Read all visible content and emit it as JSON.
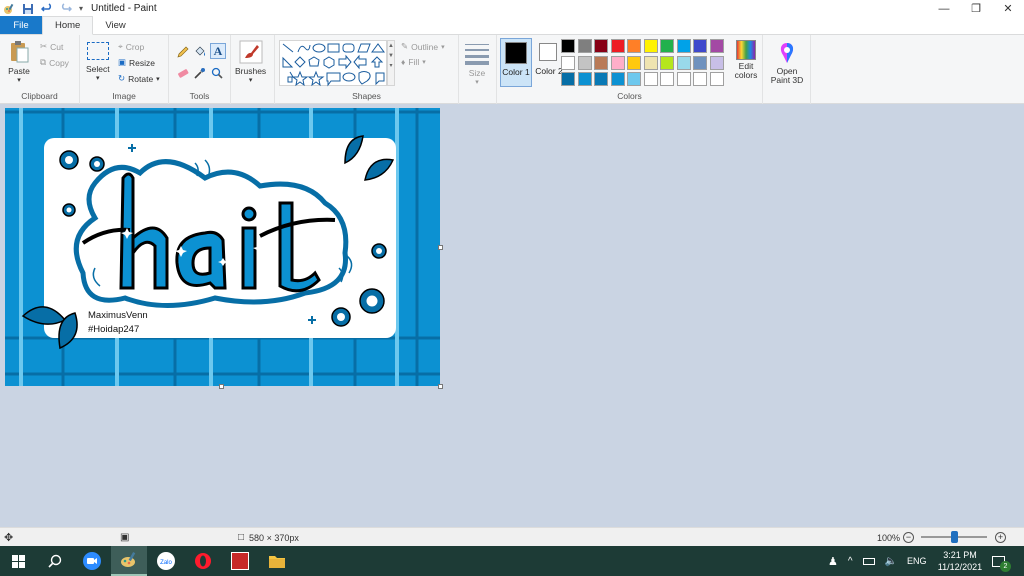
{
  "window": {
    "title": "Untitled - Paint"
  },
  "tabs": [
    {
      "label": "File"
    },
    {
      "label": "Home"
    },
    {
      "label": "View"
    }
  ],
  "clipboard": {
    "paste": "Paste",
    "cut": "Cut",
    "copy": "Copy",
    "group": "Clipboard"
  },
  "image": {
    "select": "Select",
    "crop": "Crop",
    "resize": "Resize",
    "rotate": "Rotate",
    "group": "Image"
  },
  "tools": {
    "group": "Tools",
    "brushes": "Brushes"
  },
  "shapes": {
    "outline": "Outline",
    "fill": "Fill",
    "group": "Shapes"
  },
  "size": {
    "label": "Size"
  },
  "colors": {
    "color1_label": "Color 1",
    "color2_label": "Color 2",
    "color1": "#000000",
    "color2": "#ffffff",
    "edit_colors": "Edit colors",
    "group": "Colors",
    "palette": [
      [
        "#000000",
        "#7f7f7f",
        "#880015",
        "#ed1c24",
        "#ff7f27",
        "#fff200",
        "#22b14c",
        "#00a2e8",
        "#3f48cc",
        "#a349a4"
      ],
      [
        "#ffffff",
        "#c3c3c3",
        "#b97a57",
        "#ffaec9",
        "#ffc90e",
        "#efe4b0",
        "#b5e61d",
        "#99d9ea",
        "#7092be",
        "#c8bfe7"
      ],
      [
        "#076ea6",
        "#0c91d2",
        "#0a79b5",
        "#0c91d2",
        "#6dc8ee",
        "#ffffff",
        "#ffffff",
        "#ffffff",
        "#ffffff",
        "#ffffff"
      ]
    ]
  },
  "paint3d": {
    "label": "Open Paint 3D"
  },
  "artwork": {
    "word": "hait",
    "caption_name": "MaximusVenn",
    "caption_tag": "#Hoidap247"
  },
  "status": {
    "canvas_size": "580 × 370px",
    "zoom": "100%"
  },
  "taskbar": {
    "tray_lang": "ENG",
    "time": "3:21 PM",
    "date": "11/12/2021",
    "notif_count": "2"
  }
}
